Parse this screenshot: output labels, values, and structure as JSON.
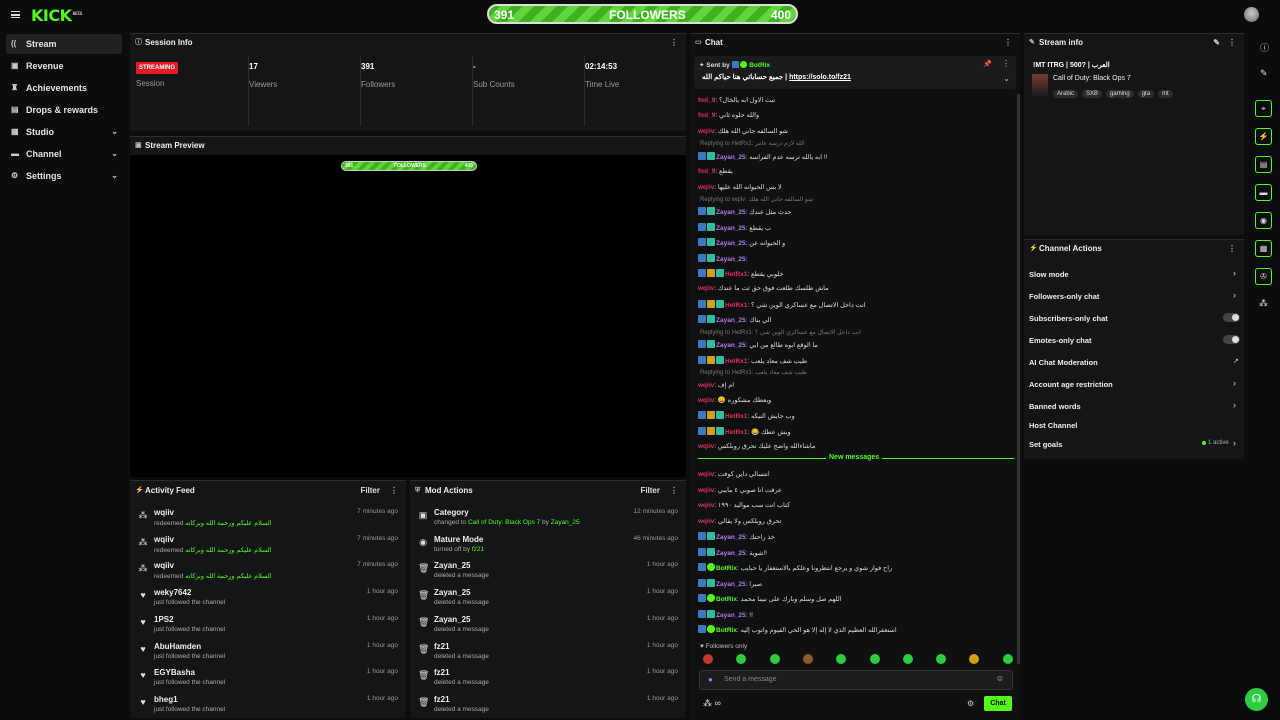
{
  "app": {
    "logo": "KICK",
    "logo_badge": "BETA"
  },
  "followers_bar": {
    "current": "391",
    "label": "FOLLOWERS",
    "goal": "400",
    "progress": 0.977
  },
  "sidebar": {
    "items": [
      {
        "label": "Stream",
        "icon": "broadcast-icon",
        "active": true
      },
      {
        "label": "Revenue",
        "icon": "revenue-icon"
      },
      {
        "label": "Achievements",
        "icon": "trophy-icon"
      },
      {
        "label": "Drops & rewards",
        "icon": "gift-icon"
      },
      {
        "label": "Studio",
        "icon": "studio-icon",
        "expandable": true
      },
      {
        "label": "Channel",
        "icon": "channel-icon",
        "expandable": true
      },
      {
        "label": "Settings",
        "icon": "gear-icon",
        "expandable": true
      }
    ]
  },
  "session": {
    "title": "Session Info",
    "status": "STREAMING",
    "status_label": "Session",
    "viewers": "17",
    "viewers_label": "Viewers",
    "followers": "391",
    "followers_label": "Followers",
    "subs": "-",
    "subs_label": "Sub Counts",
    "time": "02:14:53",
    "time_label": "Time Live"
  },
  "preview": {
    "title": "Stream Preview",
    "overlay_current": "391",
    "overlay_label": "FOLLOWERS",
    "overlay_goal": "400"
  },
  "activity": {
    "title": "Activity Feed",
    "filter": "Filter",
    "rows": [
      {
        "name": "wqiiv",
        "desc": "redeemed",
        "extra": "السلام عليكم ورحمة الله وبركاته",
        "time": "7 minutes ago",
        "icon": "redeem-icon"
      },
      {
        "name": "wqiiv",
        "desc": "redeemed",
        "extra": "السلام عليكم ورحمة الله وبركاته",
        "time": "7 minutes ago",
        "icon": "redeem-icon"
      },
      {
        "name": "wqiiv",
        "desc": "redeemed",
        "extra": "السلام عليكم ورحمة الله وبركاته",
        "time": "7 minutes ago",
        "icon": "redeem-icon"
      },
      {
        "name": "weky7642",
        "desc": "just followed the channel",
        "extra": "",
        "time": "1 hour ago",
        "icon": "heart-icon"
      },
      {
        "name": "1PS2",
        "desc": "just followed the channel",
        "extra": "",
        "time": "1 hour ago",
        "icon": "heart-icon"
      },
      {
        "name": "AbuHamden",
        "desc": "just followed the channel",
        "extra": "",
        "time": "1 hour ago",
        "icon": "heart-icon"
      },
      {
        "name": "EGYBasha",
        "desc": "just followed the channel",
        "extra": "",
        "time": "1 hour ago",
        "icon": "heart-icon"
      },
      {
        "name": "bheg1",
        "desc": "just followed the channel",
        "extra": "",
        "time": "1 hour ago",
        "icon": "heart-icon"
      }
    ]
  },
  "mod": {
    "title": "Mod Actions",
    "filter": "Filter",
    "rows": [
      {
        "name": "Category",
        "desc": "changed to",
        "extra": "Call of Duty: Black Ops 7",
        "by": "by",
        "by_user": "Zayan_25",
        "time": "12 minutes ago",
        "icon": "category-icon"
      },
      {
        "name": "Mature Mode",
        "desc": "turned off by",
        "extra": "fz21",
        "by": "",
        "by_user": "",
        "time": "46 minutes ago",
        "icon": "eye-icon"
      },
      {
        "name": "Zayan_25",
        "desc": "deleted a message",
        "extra": "",
        "by": "",
        "by_user": "",
        "time": "1 hour ago",
        "icon": "trash-icon"
      },
      {
        "name": "Zayan_25",
        "desc": "deleted a message",
        "extra": "",
        "by": "",
        "by_user": "",
        "time": "1 hour ago",
        "icon": "trash-icon"
      },
      {
        "name": "Zayan_25",
        "desc": "deleted a message",
        "extra": "",
        "by": "",
        "by_user": "",
        "time": "1 hour ago",
        "icon": "trash-icon"
      },
      {
        "name": "fz21",
        "desc": "deleted a message",
        "extra": "",
        "by": "",
        "by_user": "",
        "time": "1 hour ago",
        "icon": "trash-icon"
      },
      {
        "name": "fz21",
        "desc": "deleted a message",
        "extra": "",
        "by": "",
        "by_user": "",
        "time": "1 hour ago",
        "icon": "trash-icon"
      },
      {
        "name": "fz21",
        "desc": "deleted a message",
        "extra": "",
        "by": "",
        "by_user": "",
        "time": "1 hour ago",
        "icon": "trash-icon"
      }
    ]
  },
  "chat": {
    "title": "Chat",
    "pinned_by_label": "Sent by",
    "pinned_by": "BotRix",
    "pinned_text": "جميع حساباتي هنا حياكم الله | ",
    "pinned_link": "https://solo.to/fz21",
    "new_messages": "New messages",
    "followers_only": "Followers only",
    "input_placeholder": "Send a message",
    "send_label": "Chat",
    "infinity": "∞",
    "messages": [
      {
        "user": "fod_9",
        "text": "تبث الاول ابه يالخال؟",
        "color": "#e0305a",
        "type": "msg"
      },
      {
        "user": "fod_9",
        "text": "والله حلوه ثاني",
        "color": "#e0305a",
        "type": "msg"
      },
      {
        "user": "wqiiv",
        "text": "شو السالفه جاني الله هلك",
        "color": "#e0305a",
        "type": "msg"
      },
      {
        "user": "Replying to HetRx1: الله لازم درسه عامر",
        "type": "reply"
      },
      {
        "user": "Zayan_25",
        "text": "ابه يالله ترسه عدم الفراسه !!",
        "color": "#b47ae8",
        "type": "mod"
      },
      {
        "user": "fod_9",
        "text": "يقطع",
        "color": "#e0305a",
        "type": "msg"
      },
      {
        "user": "wqiiv",
        "text": "لا بس الحيوانه الله عليها",
        "color": "#e0305a",
        "type": "msg"
      },
      {
        "user": "Replying to wqiiv: شو السالفه جاني الله هلك",
        "type": "reply"
      },
      {
        "user": "Zayan_25",
        "text": "حدث مثل عندك",
        "color": "#b47ae8",
        "type": "mod"
      },
      {
        "user": "Zayan_25",
        "text": "ب يقطع",
        "color": "#b47ae8",
        "type": "mod"
      },
      {
        "user": "Zayan_25",
        "text": "و الحيوانه عن",
        "color": "#b47ae8",
        "type": "mod"
      },
      {
        "user": "Zayan_25",
        "text": "",
        "color": "#b47ae8",
        "type": "mod"
      },
      {
        "user": "HetRx1",
        "text": "خلوبي يقطع",
        "color": "#e0305a",
        "type": "mod2"
      },
      {
        "user": "wqiiv",
        "text": "ماش طلسك طلعت فوق حق ثت ما عندك",
        "color": "#e0305a",
        "type": "msg"
      },
      {
        "user": "HetRx1",
        "text": "انت داخل الاتصال مع عساكري الوين شي ؟",
        "color": "#e0305a",
        "type": "mod2"
      },
      {
        "user": "Zayan_25",
        "text": "الي بناك",
        "color": "#b47ae8",
        "type": "mod"
      },
      {
        "user": "Replying to HetRx1: انت داخل الاتصال مع عساكري الوين شي ؟",
        "type": "reply"
      },
      {
        "user": "Zayan_25",
        "text": "ما الوقع ابوه طالع من ابي",
        "color": "#b47ae8",
        "type": "mod"
      },
      {
        "user": "HetRx1",
        "text": "طيب شف معاد يلعب",
        "color": "#e0305a",
        "type": "mod2"
      },
      {
        "user": "Replying to HetRx1: طيب شف معاد يلعب",
        "type": "reply"
      },
      {
        "user": "wqiiv",
        "text": "ام إف",
        "color": "#e0305a",
        "type": "msg"
      },
      {
        "user": "wqiiv",
        "text": "😄 ويعطك مشكوره",
        "color": "#e0305a",
        "type": "msg"
      },
      {
        "user": "HetRx1",
        "text": "وب جايش النيكه",
        "color": "#e0305a",
        "type": "mod2"
      },
      {
        "user": "HetRx1",
        "text": "😂 ويش عطك",
        "color": "#e0305a",
        "type": "mod2"
      },
      {
        "user": "wqiiv",
        "text": "ماشاءالله واضح عليك تحرق روبلكس",
        "color": "#e0305a",
        "type": "msg"
      }
    ],
    "new_msgs": [
      {
        "user": "wqiiv",
        "text": "انتسالي داين كوفت",
        "color": "#e0305a",
        "type": "msg"
      },
      {
        "user": "wqiiv",
        "text": "عرفت انا صوبي ٤ مايبي",
        "color": "#e0305a",
        "type": "msg"
      },
      {
        "user": "wqiiv",
        "text": "كناب انت سب مواليد ١٩٩٠",
        "color": "#e0305a",
        "type": "msg"
      },
      {
        "user": "wqiiv",
        "text": "تحرق روبلكس ولا يقالي",
        "color": "#e0305a",
        "type": "msg"
      },
      {
        "user": "Zayan_25",
        "text": "خذ راحتك",
        "color": "#b47ae8",
        "type": "mod"
      },
      {
        "user": "Zayan_25",
        "text": "شوية!!",
        "color": "#b47ae8",
        "type": "mod"
      },
      {
        "user": "BotRix",
        "text": "راح فواز شوي و يرجع انتظرونا وعلكم بالاستغفار يا حبايب",
        "color": "#53fc18",
        "type": "bot"
      },
      {
        "user": "Zayan_25",
        "text": "صبرا",
        "color": "#b47ae8",
        "type": "mod"
      },
      {
        "user": "BotRix",
        "text": "اللهم صل وسلم وبارك على نبينا محمد",
        "color": "#53fc18",
        "type": "bot"
      },
      {
        "user": "Zayan_25",
        "text": "!!",
        "color": "#b47ae8",
        "type": "mod"
      },
      {
        "user": "BotRix",
        "text": "استغفرالله العظيم الذي لا إله إلا هو الحي القيوم واتوب إليه",
        "color": "#53fc18",
        "type": "bot"
      }
    ]
  },
  "stream_info": {
    "title_label": "Stream info",
    "title": "!MT ITRG | 500? | العرب",
    "category": "Call of Duty: Black Ops 7",
    "tags": [
      "Arabic",
      "SXB",
      "gaming",
      "gta",
      "mt"
    ]
  },
  "channel_actions": {
    "title": "Channel Actions",
    "items": [
      {
        "label": "Slow mode",
        "control": "arrow"
      },
      {
        "label": "Followers-only chat",
        "control": "arrow"
      },
      {
        "label": "Subscribers-only chat",
        "control": "toggle"
      },
      {
        "label": "Emotes-only chat",
        "control": "toggle"
      },
      {
        "label": "AI Chat Moderation",
        "control": "external"
      },
      {
        "label": "Account age restriction",
        "control": "arrow"
      },
      {
        "label": "Banned words",
        "control": "arrow"
      },
      {
        "label": "Host Channel",
        "control": "none"
      },
      {
        "label": "Set goals",
        "control": "arrow",
        "note": "1 active"
      }
    ]
  },
  "colors": {
    "brand": "#53fc18",
    "live": "#e31b23",
    "mod_user": "#b47ae8",
    "viewer_user": "#e0305a"
  }
}
